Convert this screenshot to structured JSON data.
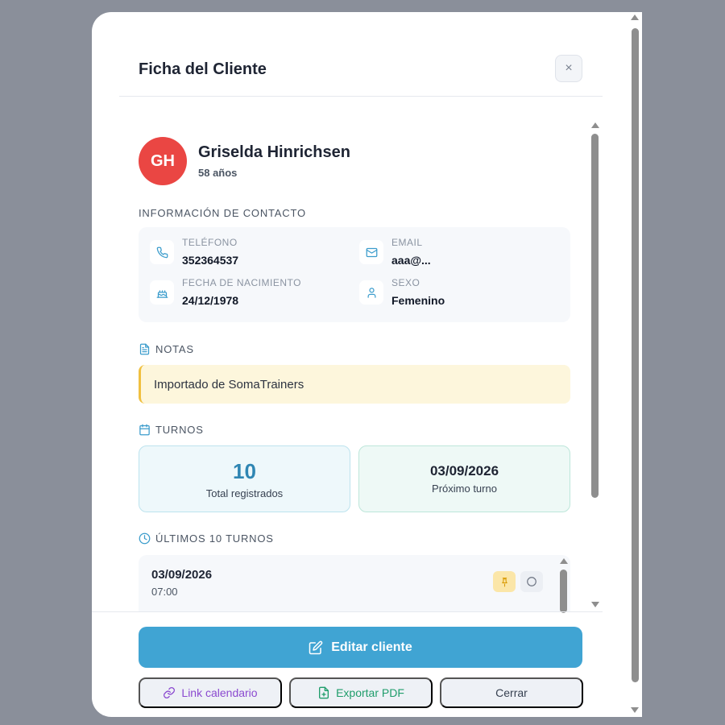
{
  "header": {
    "title": "Ficha del Cliente",
    "close_glyph": "×"
  },
  "client": {
    "initials": "GH",
    "name": "Griselda Hinrichsen",
    "age": "58 años"
  },
  "contact": {
    "section_label": "INFORMACIÓN DE CONTACTO",
    "phone": {
      "label": "TELÉFONO",
      "value": "352364537",
      "icon": "phone-icon"
    },
    "email": {
      "label": "EMAIL",
      "value": "aaa@...",
      "icon": "mail-icon"
    },
    "birth": {
      "label": "FECHA DE NACIMIENTO",
      "value": "24/12/1978",
      "icon": "cake-icon"
    },
    "sex": {
      "label": "SEXO",
      "value": "Femenino",
      "icon": "user-icon"
    }
  },
  "notes": {
    "section_label": "NOTAS",
    "text": "Importado de SomaTrainers"
  },
  "appointments": {
    "section_label": "TURNOS",
    "total": {
      "value": "10",
      "caption": "Total registrados"
    },
    "next": {
      "value": "03/09/2026",
      "caption": "Próximo turno"
    }
  },
  "recent": {
    "section_label": "ÚLTIMOS 10 TURNOS",
    "items": [
      {
        "date": "03/09/2026",
        "time": "07:00"
      }
    ]
  },
  "actions": {
    "edit": "Editar cliente",
    "calendar_link": "Link calendario",
    "export_pdf": "Exportar PDF",
    "close": "Cerrar"
  },
  "colors": {
    "accent": "#40a4d3",
    "avatar": "#ea4643",
    "notes_bg": "#fdf6dc",
    "notes_border": "#f0c040"
  }
}
